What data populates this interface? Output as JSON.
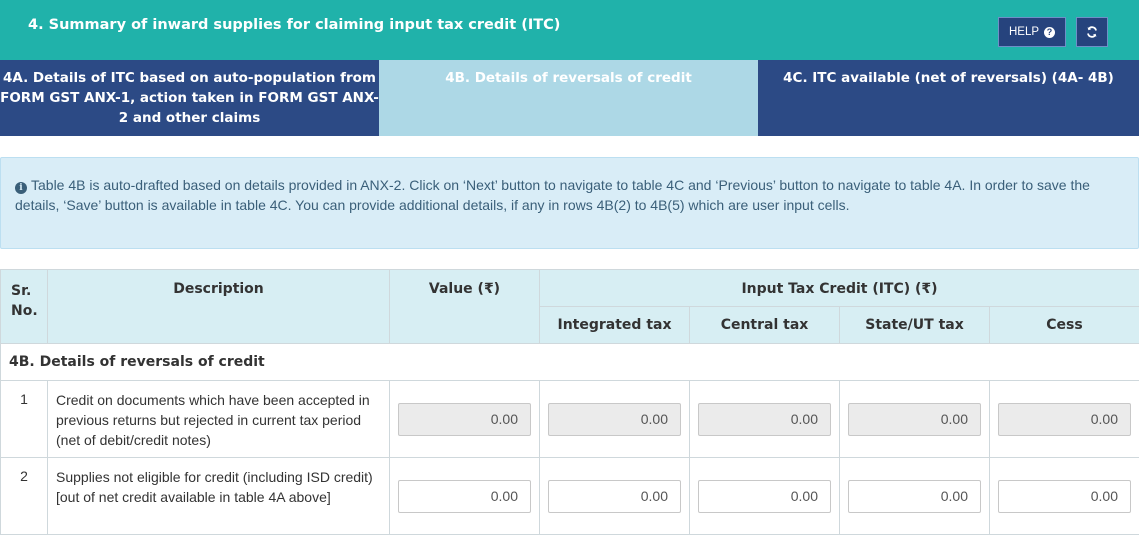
{
  "header": {
    "title": "4. Summary of inward supplies for claiming input tax credit (ITC)",
    "help_label": "HELP",
    "colors": {
      "bar": "#20b2aa",
      "button": "#26437d"
    }
  },
  "tabs": [
    {
      "label": "4A. Details of ITC based on auto-population from FORM GST ANX-1, action taken in FORM GST ANX-2 and other claims",
      "active": false
    },
    {
      "label": "4B. Details of reversals of credit",
      "active": true
    },
    {
      "label": "4C. ITC available (net of reversals) (4A- 4B)",
      "active": false
    }
  ],
  "info": {
    "text": "Table 4B is auto-drafted based on details provided in ANX-2. Click on ‘Next’ button to navigate to table 4C and ‘Previous’ button to navigate to table 4A. In order to save the details, ‘Save’ button is available in table 4C. You can provide additional details, if any in rows 4B(2) to 4B(5) which are user input cells."
  },
  "table": {
    "headers": {
      "sr_no": "Sr. No.",
      "description": "Description",
      "value": "Value (₹)",
      "itc_group": "Input Tax Credit (ITC) (₹)",
      "integrated_tax": "Integrated tax",
      "central_tax": "Central tax",
      "state_ut_tax": "State/UT tax",
      "cess": "Cess"
    },
    "section_title": "4B. Details of reversals of credit",
    "rows": [
      {
        "sr": "1",
        "description": "Credit on documents which have been accepted in previous returns but rejected in current tax period (net of debit/credit notes)",
        "value": "0.00",
        "integrated_tax": "0.00",
        "central_tax": "0.00",
        "state_ut_tax": "0.00",
        "cess": "0.00",
        "readonly": true
      },
      {
        "sr": "2",
        "description": "Supplies not eligible for credit (including ISD credit) [out of net credit available in table 4A above]",
        "value": "0.00",
        "integrated_tax": "0.00",
        "central_tax": "0.00",
        "state_ut_tax": "0.00",
        "cess": "0.00",
        "readonly": false
      }
    ]
  }
}
